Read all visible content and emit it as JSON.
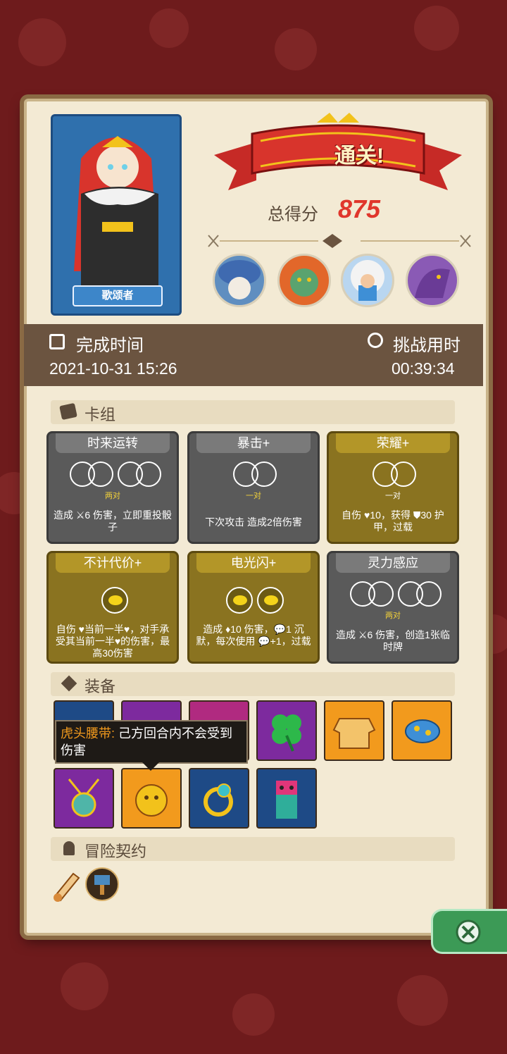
{
  "hero": {
    "name": "歌颂者"
  },
  "result": {
    "banner": "通关!",
    "score_label": "总得分",
    "score": "875"
  },
  "enemies": [
    "mushroom-elder-icon",
    "orange-orc-icon",
    "yeti-icon",
    "purple-dragon-icon"
  ],
  "time": {
    "finish_label": "完成时间",
    "finish_value": "2021-10-31 15:26",
    "challenge_label": "挑战用时",
    "challenge_value": "00:39:34"
  },
  "deck": {
    "title": "卡组",
    "cards": [
      {
        "name": "时来运转",
        "sub": "两对",
        "desc": "造成 ⚔6 伤害，立即重投骰子",
        "style": "gray"
      },
      {
        "name": "暴击+",
        "sub": "一对",
        "desc": "下次攻击 造成2倍伤害",
        "style": "gray"
      },
      {
        "name": "荣耀+",
        "sub": "一对",
        "desc": "自伤 ♥10，获得 ⛊30 护甲，过载",
        "style": "gold"
      },
      {
        "name": "不计代价+",
        "sub": "",
        "desc": "自伤 ♥当前一半♥，对手承受其当前一半♥的伤害，最高30伤害",
        "style": "gold"
      },
      {
        "name": "电光闪+",
        "sub": "",
        "desc": "造成 ♦10 伤害，💬1 沉默，每次使用 💬+1，过载",
        "style": "gold"
      },
      {
        "name": "灵力感应",
        "sub": "两对",
        "desc": "造成 ⚔6 伤害，创造1张临时牌",
        "style": "gray"
      }
    ]
  },
  "equipment": {
    "title": "装备",
    "tooltip_name": "虎头腰带:",
    "tooltip_text": "己方回合内不会受到伤害"
  },
  "contracts": {
    "title": "冒险契约"
  }
}
